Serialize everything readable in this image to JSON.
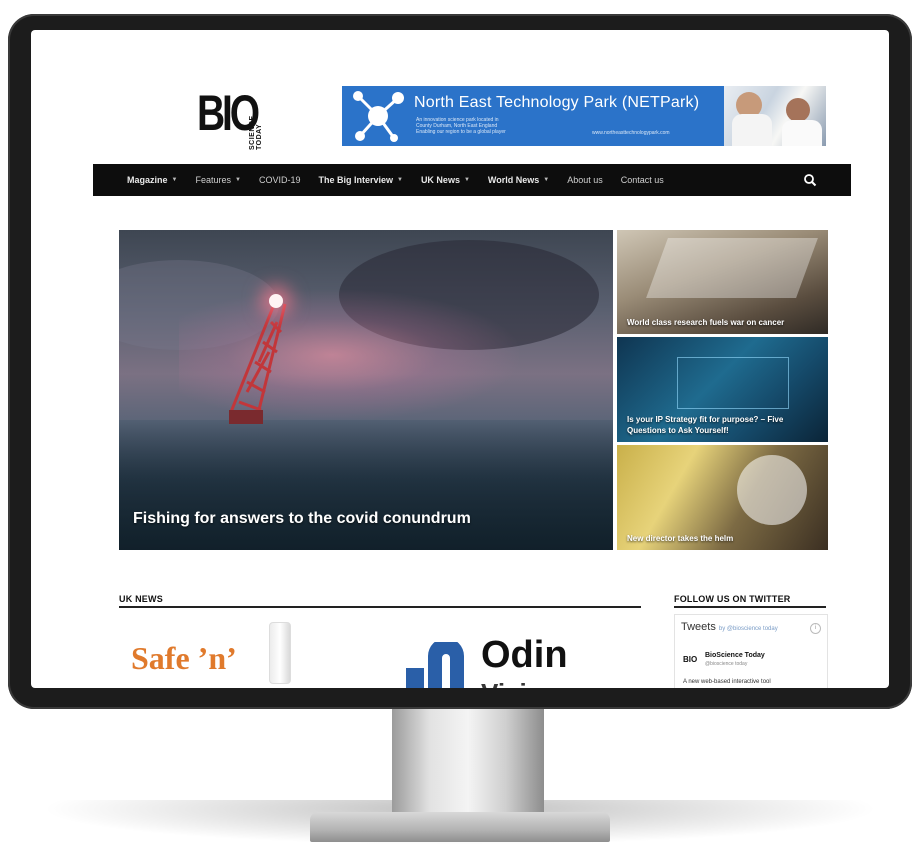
{
  "site": {
    "logo_main": "BIO",
    "logo_sub": "SCIENCE TODAY"
  },
  "banner": {
    "title": "North East Technology Park (NETPark)",
    "lines": [
      "An innovation science park located in",
      "County Durham, North East England",
      "Enabling our region to be a global player"
    ],
    "url": "www.northeasttechnologypark.com"
  },
  "nav": {
    "items": [
      {
        "label": "Magazine",
        "caret": true,
        "bold": true
      },
      {
        "label": "Features",
        "caret": true,
        "bold": false
      },
      {
        "label": "COVID-19",
        "caret": false,
        "bold": false
      },
      {
        "label": "The Big Interview",
        "caret": true,
        "bold": true
      },
      {
        "label": "UK News",
        "caret": true,
        "bold": true
      },
      {
        "label": "World News",
        "caret": true,
        "bold": true
      },
      {
        "label": "About us",
        "caret": false,
        "bold": false
      },
      {
        "label": "Contact us",
        "caret": false,
        "bold": false
      }
    ],
    "caret_glyph": "▼",
    "search_icon": "search-icon"
  },
  "hero": {
    "main_title": "Fishing for answers to the covid conundrum",
    "tiles": [
      {
        "title": "World class research fuels war on cancer"
      },
      {
        "title": "Is your IP Strategy fit for purpose? – Five Questions to Ask Yourself!"
      },
      {
        "title": "New director takes the helm"
      }
    ]
  },
  "sections": {
    "uk_news": "UK NEWS",
    "twitter": "FOLLOW US ON TWITTER"
  },
  "uk_news_items": {
    "safe_text": "Safe ’n’",
    "odin_text": "Odin",
    "odin_text2": "Vision"
  },
  "tweets": {
    "heading": "Tweets",
    "by": "by @bioscience today",
    "info": "i",
    "avatar_text": "BIO",
    "account_name": "BioScience Today",
    "account_handle": "@bioscience today",
    "text": "A new web-based interactive tool"
  },
  "colors": {
    "nav_bg": "#0d0d0d",
    "banner_bg": "#2b73c9",
    "accent_orange": "#e07a2c",
    "odin_blue": "#2a5fa8"
  }
}
